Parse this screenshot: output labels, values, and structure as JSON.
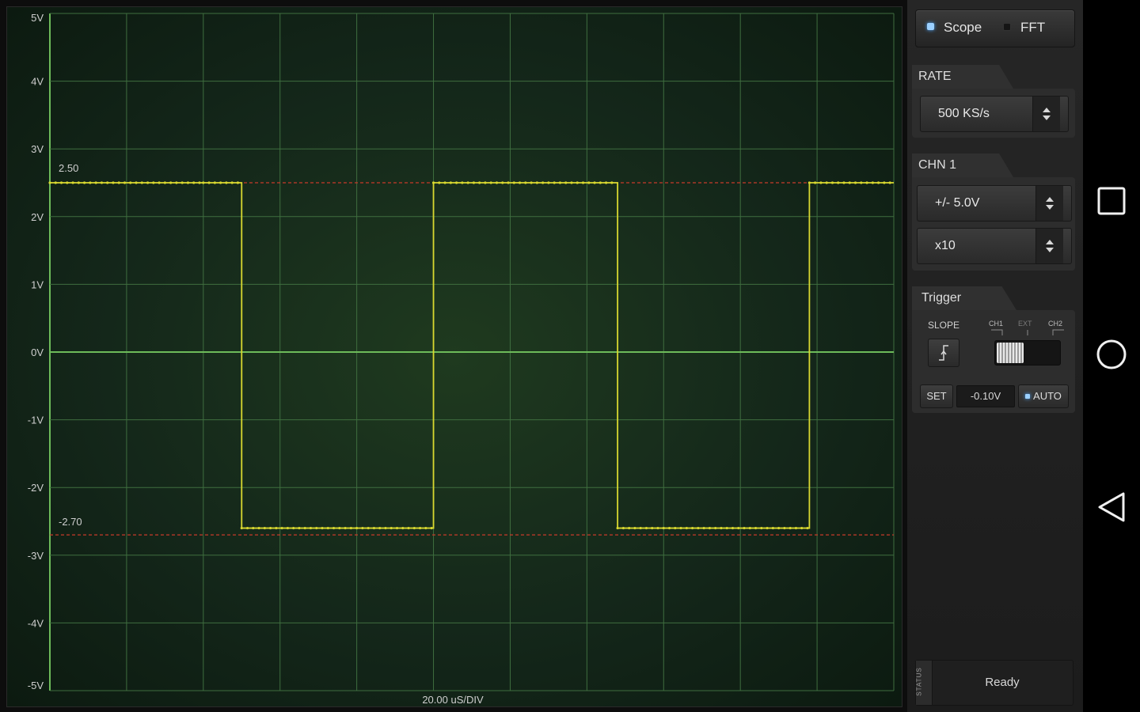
{
  "scope": {
    "y_axis_labels": [
      "5V",
      "4V",
      "3V",
      "2V",
      "1V",
      "0V",
      "-1V",
      "-2V",
      "-3V",
      "-4V",
      "-5V"
    ],
    "time_div_label": "20.00 uS/DIV",
    "cursor_high_label": "2.50",
    "cursor_low_label": "-2.70",
    "cursor_high_v": 2.5,
    "cursor_low_v": -2.7,
    "grid_divisions_x": 11,
    "grid_divisions_y": 10,
    "colors": {
      "trace": "#d8d830",
      "grid": "#3f6e3f",
      "zero_line": "#6dbb5a",
      "cursor": "#c83a2a",
      "text": "#cfcfcf"
    }
  },
  "chart_data": {
    "type": "line",
    "xlabel": "20.00 uS/DIV",
    "ylim": [
      -5,
      5
    ],
    "xlim_div": [
      0,
      11
    ],
    "series": [
      {
        "values_v_at_div": [
          [
            0.0,
            2.5
          ],
          [
            2.0,
            2.5
          ],
          [
            2.5,
            2.5
          ],
          [
            2.5,
            -2.6
          ],
          [
            5.0,
            -2.6
          ],
          [
            5.0,
            2.5
          ],
          [
            7.4,
            2.5
          ],
          [
            7.4,
            -2.6
          ],
          [
            9.9,
            -2.6
          ],
          [
            9.9,
            2.5
          ],
          [
            11.0,
            2.5
          ]
        ]
      }
    ]
  },
  "mode": {
    "scope_label": "Scope",
    "fft_label": "FFT",
    "selected": "Scope"
  },
  "rate": {
    "title": "RATE",
    "value": "500 KS/s"
  },
  "channel": {
    "title": "CHN 1",
    "range": "+/- 5.0V",
    "probe": "x10"
  },
  "trigger": {
    "title": "Trigger",
    "slope_label": "SLOPE",
    "source_ch1": "CH1",
    "source_ext": "EXT",
    "source_ch2": "CH2",
    "set_label": "SET",
    "level_value": "-0.10V",
    "auto_label": "AUTO",
    "slope_icon": "rising-edge-icon"
  },
  "status": {
    "tab_label": "STATUS",
    "text": "Ready"
  },
  "nav": {
    "recent_icon": "square-icon",
    "home_icon": "circle-icon",
    "back_icon": "triangle-back-icon"
  }
}
